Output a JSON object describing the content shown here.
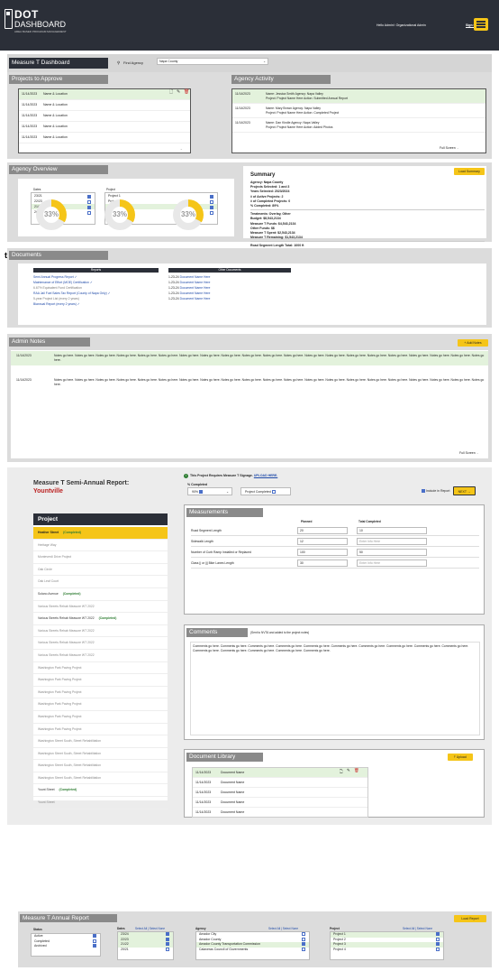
{
  "header": {
    "logo_line1": "DOT",
    "logo_line2": "DASHBOARD",
    "tagline": "AREA BASED PROGRAM MANAGEMENT",
    "hello": "Hello Admin!: Organizational Admin",
    "sign_out": "Sign Out"
  },
  "top": {
    "title": "Measure T Dashboard",
    "find_label": "Find Agency",
    "agency_value": "Napa County"
  },
  "projects_to_approve": {
    "title": "Projects to Approve",
    "rows": [
      {
        "date": "11/14/2023",
        "name": "Name & Location"
      },
      {
        "date": "11/14/2023",
        "name": "Name & Location"
      },
      {
        "date": "11/14/2023",
        "name": "Name & Location"
      },
      {
        "date": "11/14/2023",
        "name": "Name & Location"
      },
      {
        "date": "11/14/2023",
        "name": "Name & Location"
      }
    ]
  },
  "agency_activity": {
    "title": "Agency Activity",
    "full_label": "Full Screen",
    "rows": [
      {
        "date": "11/14/2023",
        "l1": "Name: Jessica Smith    Agency: Napa Valley",
        "l2": "Project: Project Name Here    Action: Submitted Annual Report"
      },
      {
        "date": "11/14/2023",
        "l1": "Name: Mary Brown    Agency: Napa Valley",
        "l2": "Project: Project Name Here    Action: Completed Project"
      },
      {
        "date": "11/14/2023",
        "l1": "Name: Dan Kindle    Agency: Napa Valley",
        "l2": "Project: Project Name Here    Action: Added Photos"
      }
    ]
  },
  "overview": {
    "title": "Agency Overview",
    "dates_label": "Dates",
    "project_label": "Project",
    "dates": [
      {
        "label": "23/21",
        "on": true
      },
      {
        "label": "22/23",
        "on": false
      },
      {
        "label": "21/22",
        "on": true
      },
      {
        "label": "20/21",
        "on": false
      }
    ],
    "projects": [
      {
        "label": "Project 1",
        "on": true
      },
      {
        "label": "Project 2",
        "on": false
      },
      {
        "label": "Project 3",
        "on": true
      },
      {
        "label": "Project 4",
        "on": false
      }
    ],
    "rings": [
      "33",
      "33",
      "33"
    ],
    "summary_title": "Summary",
    "load_summary": "Load Summary",
    "s1": [
      "Agency: Napa County",
      "Projects Selected: 1 and 3",
      "Years Selected: 2023/2024",
      "# of Active Projects: 2",
      "# of Completed Projects: 0",
      "% Completed: 89%"
    ],
    "s2": [
      "Treatments: Overlay, Other",
      "Budget: $8,543,2134",
      "Measure T Funds: $4,543,2134",
      "Other Funds: $$",
      "Measure T Spent: $2,543,2134",
      "Measure T Remaining: $1,543,2134"
    ],
    "s3": [
      "Road Segment Length Total: 1000 ft",
      "Sidewalk Length Total: 1000 ft",
      "Number of Curb Ramp Installed / Replaced Total: 1000 ft",
      "Class || or ||| Bike Lanes Length Total: 1000 ft"
    ]
  },
  "documents": {
    "title": "Documents",
    "reports_head": "Reports",
    "other_head": "Other Documents",
    "reports": [
      "Semi Annual Progress Report  ✓",
      "Maintenance of Effort (MOE) Certification  ✓",
      "6.67% Equivalent Fund Certification",
      "RAA Jail Fuel Sales Tax Report (County of Napa Only)  ✓",
      "5-year Project List (every 2 years)",
      "Biannual Report (every 2 years)  ✓"
    ],
    "other": [
      {
        "date": "1-23-24",
        "name": "Document Name Here"
      },
      {
        "date": "1-23-24",
        "name": "Document Name Here"
      },
      {
        "date": "1-23-24",
        "name": "Document Name Here"
      },
      {
        "date": "1-23-24",
        "name": "Document Name Here"
      },
      {
        "date": "1-23-24",
        "name": "Document Name Here"
      }
    ]
  },
  "admin_notes": {
    "title": "Admin Notes",
    "add": "+ Add Notes",
    "full": "Full Screen",
    "notes": [
      {
        "date": "11/14/2023",
        "text": "Notes go here. Notes go here. Notes go here. Notes go here. Notes go here. Notes go here. Notes go here. Notes go here. Notes go here. Notes go here. Notes go here. Notes go here. Notes go here. Notes go here. Notes go here. Notes go here. Notes go here. Notes go here. Notes go here. Notes go here. Notes go here."
      },
      {
        "date": "11/14/2023",
        "text": "Notes go here. Notes go here. Notes go here. Notes go here. Notes go here. Notes go here. Notes go here. Notes go here. Notes go here. Notes go here. Notes go here. Notes go here. Notes go here. Notes go here. Notes go here. Notes go here. Notes go here. Notes go here. Notes go here. Notes go here. Notes go here."
      }
    ]
  },
  "report": {
    "title": "Measure T Semi-Annual Report:",
    "city": "Yountville",
    "project_head": "Project",
    "signage": "This Project Requires Measure T Signage.",
    "upload_here": "UPLOAD HERE.",
    "pct_label": "% Completed",
    "pct_value": "90%",
    "proj_completed": "Project Completed",
    "include": "Include in Report",
    "next": "NEXT →",
    "projects": [
      {
        "name": "Heather Street",
        "status": "(Completed)"
      },
      {
        "name": "Heritage Way",
        "status": ""
      },
      {
        "name": "Monteverdi Drive Project",
        "status": ""
      },
      {
        "name": "Oak Circle",
        "status": ""
      },
      {
        "name": "Oak Leaf Court",
        "status": ""
      },
      {
        "name": "Solano Avenue",
        "status": "(Completed)"
      },
      {
        "name": "Various Streets Rehab Measure WT 2022",
        "status": ""
      },
      {
        "name": "Various Streets Rehab Measure WT 2022",
        "status": "(Completed)"
      },
      {
        "name": "Various Streets Rehab Measure WT 2022",
        "status": ""
      },
      {
        "name": "Various Streets Rehab Measure WT 2022",
        "status": ""
      },
      {
        "name": "Various Streets Rehab Measure WT 2022",
        "status": ""
      },
      {
        "name": "Washington Park Paving Project",
        "status": ""
      },
      {
        "name": "Washington Park Paving Project",
        "status": ""
      },
      {
        "name": "Washington Park Paving Project",
        "status": ""
      },
      {
        "name": "Washington Park Paving Project",
        "status": ""
      },
      {
        "name": "Washington Park Paving Project",
        "status": ""
      },
      {
        "name": "Washington Park Paving Project",
        "status": ""
      },
      {
        "name": "Washington Street South, Street Rehabilitation",
        "status": ""
      },
      {
        "name": "Washington Street South, Street Rehabilitation",
        "status": ""
      },
      {
        "name": "Washington Street South, Street Rehabilitation",
        "status": ""
      },
      {
        "name": "Washington Street South, Street Rehabilitation",
        "status": ""
      },
      {
        "name": "Yount Street",
        "status": "(Completed)"
      },
      {
        "name": "Yount Street",
        "status": ""
      }
    ],
    "measurements_title": "Measurements",
    "planned": "Planned",
    "total_completed": "Total Completed",
    "measurements": [
      {
        "label": "Road Segment Length",
        "planned": "20",
        "total": "10"
      },
      {
        "label": "Sidewalk Length",
        "planned": "12",
        "total": "Enter Info Here"
      },
      {
        "label": "Number of Curb Ramp Installed or Replaced",
        "planned": "100",
        "total": "50"
      },
      {
        "label": "Class || or ||| Bike Lanes Length",
        "planned": "30",
        "total": "Enter Info Here"
      }
    ],
    "comments_title": "Comments",
    "comments_note": "(Sent to NVTA and added to the project notes)",
    "comments_text": "Comments go here. Comments go here. Comments go here. Comments go here. Comments go here. Comments go here. Comments go here. Comments go here. Comments go here. Comments go here. Comments go here. Comments go here. Comments go here. Comments go here. Comments go here.",
    "library_title": "Document Library",
    "upload": "Upload",
    "docs": [
      {
        "date": "11/14/2023",
        "name": "Document Name"
      },
      {
        "date": "11/14/2023",
        "name": "Document Name"
      },
      {
        "date": "11/14/2023",
        "name": "Document Name"
      },
      {
        "date": "11/14/2023",
        "name": "Document Name"
      },
      {
        "date": "11/14/2023",
        "name": "Document Name"
      }
    ]
  },
  "annual": {
    "title": "Measure T Annual Report",
    "load": "Load Report",
    "status_label": "Status",
    "dates_label": "Dates",
    "agency_label": "Agency",
    "project_label": "Project",
    "select_all": "Select All  |  Select None",
    "status": [
      {
        "label": "Active",
        "on": true
      },
      {
        "label": "Completed",
        "on": false
      },
      {
        "label": "Archived",
        "on": true
      }
    ],
    "dates": [
      {
        "label": "23/24",
        "on": true
      },
      {
        "label": "22/23",
        "on": true
      },
      {
        "label": "21/22",
        "on": true
      },
      {
        "label": "20/21",
        "on": false
      }
    ],
    "agencies": [
      {
        "label": "Amador City",
        "on": false
      },
      {
        "label": "Amador County",
        "on": false
      },
      {
        "label": "Amador County Transportation Commission",
        "on": true
      },
      {
        "label": "Calaveras Council of Governments",
        "on": false
      }
    ],
    "projects": [
      {
        "label": "Project 1",
        "on": true
      },
      {
        "label": "Project 2",
        "on": false
      },
      {
        "label": "Project 3",
        "on": true
      },
      {
        "label": "Project 4",
        "on": false
      }
    ]
  }
}
